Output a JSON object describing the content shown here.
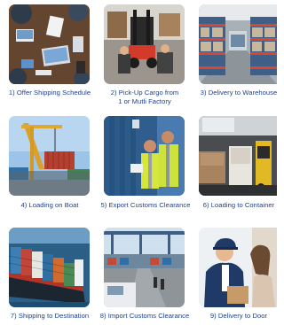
{
  "steps": [
    {
      "label": "1) Offer Shipping Schedule",
      "icon": "planning-desk-photo"
    },
    {
      "label_line1": "2) Pick-Up Cargo from",
      "label_line2": "1 or Mutli Factory",
      "icon": "forklift-warehouse-photo"
    },
    {
      "label": "3) Delivery to Warehouse",
      "icon": "warehouse-racks-photo"
    },
    {
      "label": "4) Loading on Boat",
      "icon": "port-crane-container-photo"
    },
    {
      "label": "5) Export Customs Clearance",
      "icon": "customs-inspection-photo"
    },
    {
      "label": "6) Loading to Container",
      "icon": "container-loading-photo"
    },
    {
      "label": "7) Shipping to Destination",
      "icon": "container-ship-photo"
    },
    {
      "label": "8) Import Customs Clearance",
      "icon": "port-terminal-photo"
    },
    {
      "label": "9) Delivery to Door",
      "icon": "courier-delivery-photo"
    }
  ],
  "colors": {
    "label": "#1d3f8f"
  }
}
